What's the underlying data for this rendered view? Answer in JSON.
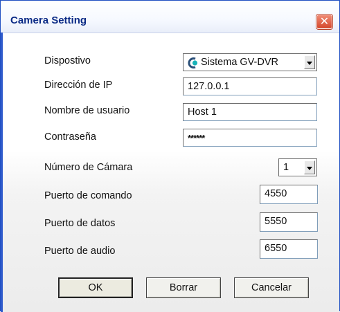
{
  "window": {
    "title": "Camera Setting",
    "close_glyph": "✕"
  },
  "form": {
    "device": {
      "label": "Dispostivo",
      "value": "Sistema GV-DVR",
      "icon": "camera-icon"
    },
    "ip": {
      "label": "Dirección de IP",
      "value": "127.0.0.1"
    },
    "username": {
      "label": "Nombre de usuario",
      "value": "Host 1"
    },
    "password": {
      "label": "Contraseña",
      "value": "******"
    },
    "camera_number": {
      "label": "Número de Cámara",
      "value": "1"
    },
    "command_port": {
      "label": "Puerto de comando",
      "value": "4550"
    },
    "data_port": {
      "label": "Puerto de datos",
      "value": "5550"
    },
    "audio_port": {
      "label": "Puerto de audio",
      "value": "6550"
    }
  },
  "buttons": {
    "ok": "OK",
    "clear": "Borrar",
    "cancel": "Cancelar"
  },
  "colors": {
    "title_text": "#0a2a85",
    "close_button": "#d4472c",
    "window_border": "#1f4fc2"
  }
}
